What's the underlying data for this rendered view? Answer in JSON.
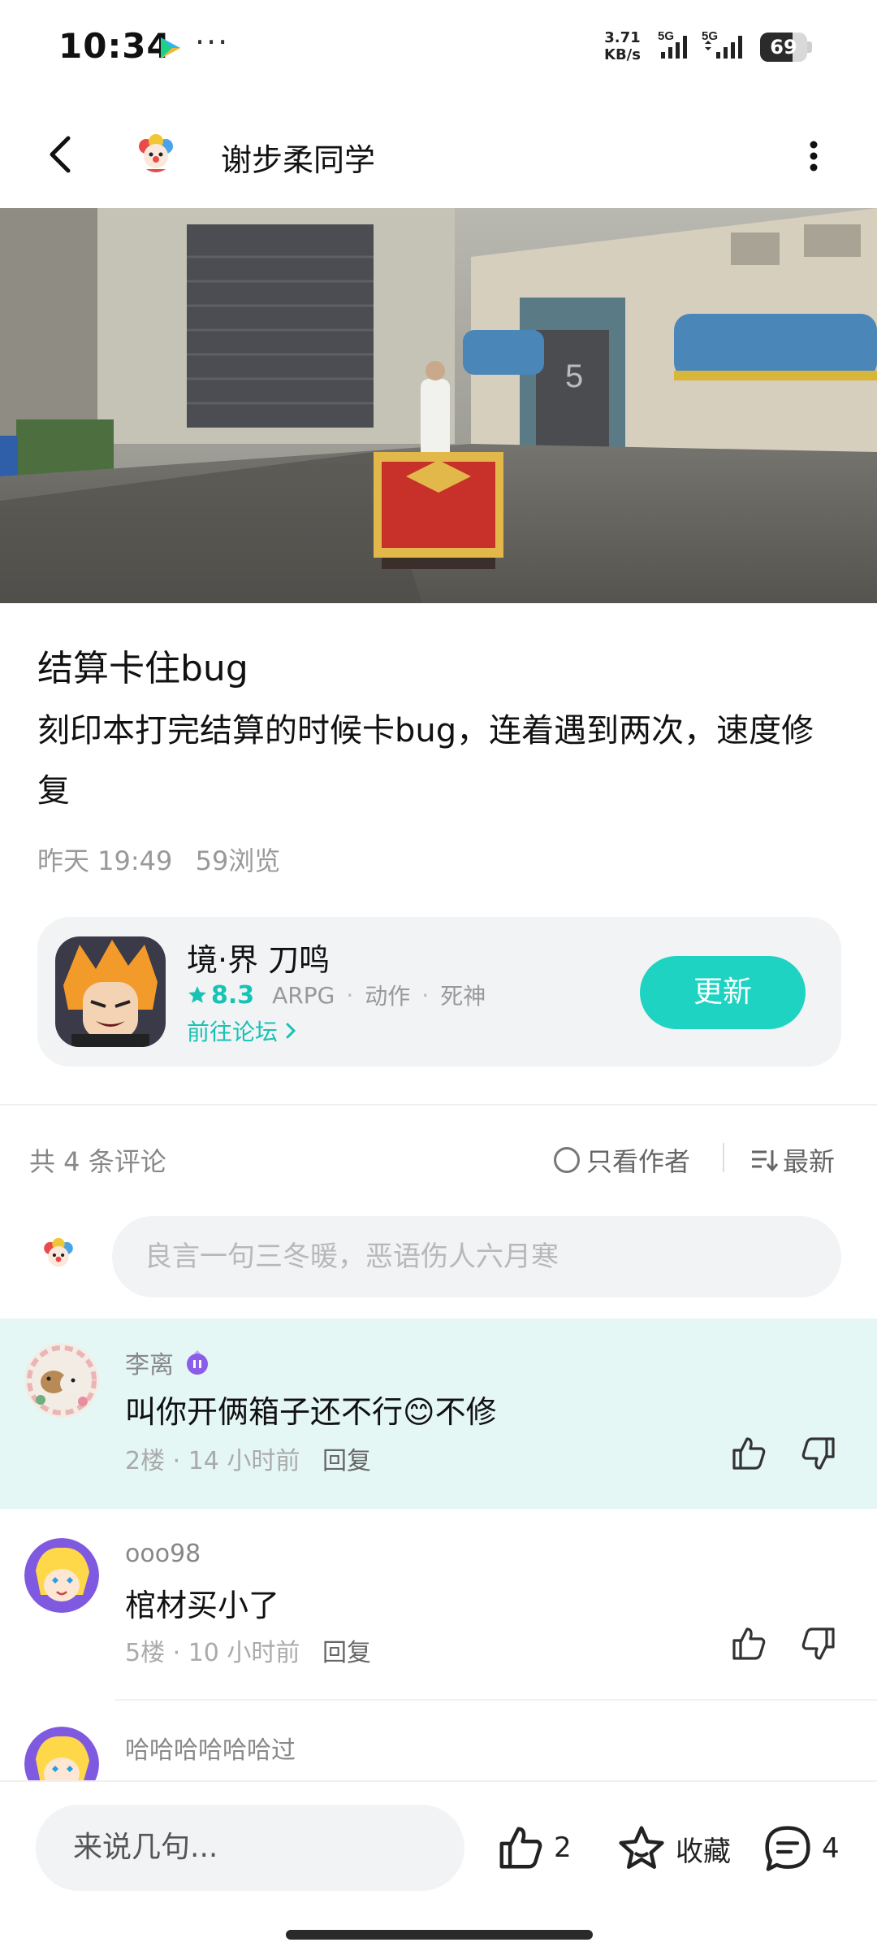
{
  "status_bar": {
    "time": "10:34",
    "dots": "···",
    "net_speed_value": "3.71",
    "net_speed_unit": "KB/s",
    "sim1_label": "5G",
    "sim2_label": "5G",
    "battery": "69"
  },
  "header": {
    "author_name": "谢步柔同学"
  },
  "post": {
    "title": "结算卡住bug",
    "body": "刻印本打完结算的时候卡bug，连着遇到两次，速度修复",
    "time": "昨天 19:49",
    "views": "59浏览"
  },
  "game_card": {
    "name": "境·界 刀鸣",
    "score": "8.3",
    "tags": [
      "ARPG",
      "动作",
      "死神"
    ],
    "forum_link": "前往论坛",
    "update_button": "更新"
  },
  "comments_header": {
    "count_text": "共 4 条评论",
    "author_only": "只看作者",
    "sort": "最新"
  },
  "comment_input": {
    "placeholder": "良言一句三冬暖，恶语伤人六月寒"
  },
  "comments": [
    {
      "user": "李离",
      "text": "叫你开俩箱子还不行😊不修",
      "floor_time": "2楼 · 14 小时前",
      "reply": "回复"
    },
    {
      "user": "ooo98",
      "text": "棺材买小了",
      "floor_time": "5楼 · 10 小时前",
      "reply": "回复"
    },
    {
      "user": "哈哈哈哈哈哈过"
    }
  ],
  "bottom_bar": {
    "say_placeholder": "来说几句...",
    "like_count": "2",
    "favorite_label": "收藏",
    "comment_count": "4"
  },
  "colors": {
    "accent": "#1ed3c2",
    "accent_text": "#18c3b4",
    "highlight_bg": "#e4f7f5"
  }
}
